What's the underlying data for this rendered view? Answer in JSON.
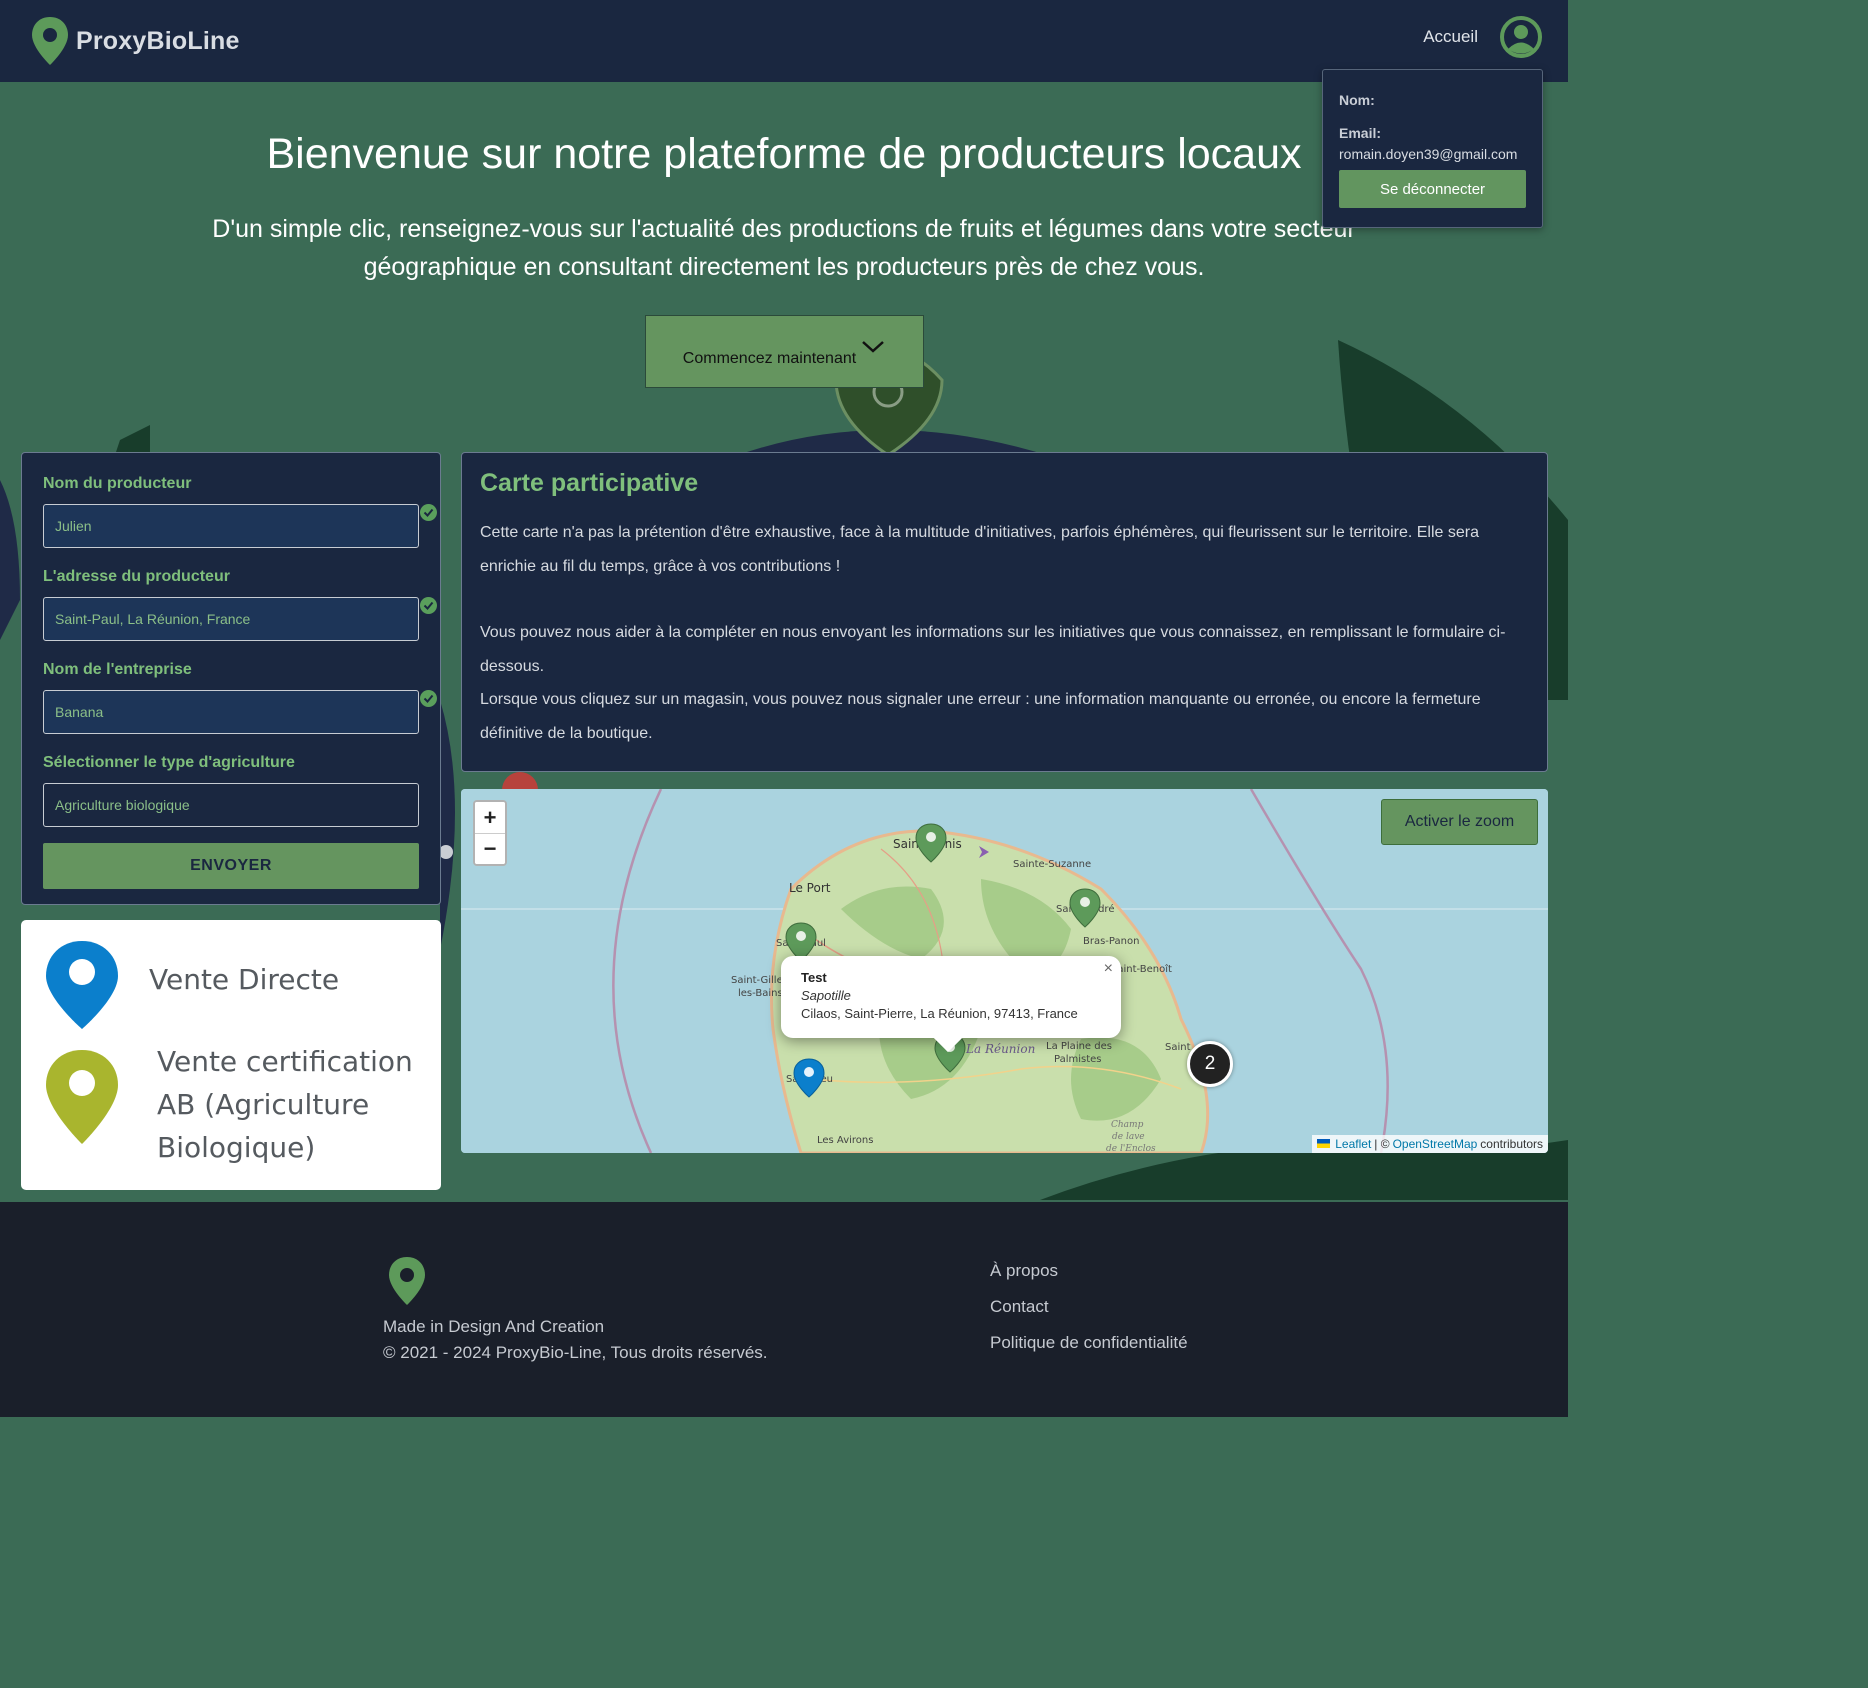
{
  "brand": {
    "name": "ProxyBioLine"
  },
  "nav": {
    "home": "Accueil"
  },
  "user_menu": {
    "name_label": "Nom:",
    "email_label": "Email:",
    "email": "romain.doyen39@gmail.com",
    "logout": "Se déconnecter"
  },
  "hero": {
    "title": "Bienvenue sur notre plateforme de producteurs locaux",
    "subtitle": "D'un simple clic, renseignez-vous sur l'actualité des productions de fruits et légumes dans votre secteur géographique en consultant directement les producteurs près de chez vous.",
    "cta": "Commencez maintenant"
  },
  "form": {
    "producer_label": "Nom du producteur",
    "producer_value": "Julien",
    "address_label": "L'adresse du producteur",
    "address_value": "Saint-Paul, La Réunion, France",
    "company_label": "Nom de l'entreprise",
    "company_value": "Banana",
    "type_label": "Sélectionner le type d'agriculture",
    "type_value": "Agriculture biologique",
    "submit": "ENVOYER"
  },
  "legend": {
    "direct": "Vente Directe",
    "certified_line1": "Vente certification",
    "certified_line2": "AB (Agriculture",
    "certified_line3": "Biologique)",
    "colors": {
      "direct": "#0b7fcc",
      "certified": "#a9b52e"
    }
  },
  "info": {
    "title": "Carte participative",
    "p1": "Cette carte n'a pas la prétention d'être exhaustive, face à la multitude d'initiatives, parfois éphémères, qui fleurissent sur le territoire. Elle sera enrichie au fil du temps, grâce à vos contributions !",
    "p2": "Vous pouvez nous aider à la compléter en nous envoyant les informations sur les initiatives que vous connaissez, en remplissant le formulaire ci-dessous.",
    "p3": "Lorsque vous cliquez sur un magasin, vous pouvez nous signaler une erreur : une information manquante ou erronée, ou encore la fermeture définitive de la boutique."
  },
  "map": {
    "zoom_in": "+",
    "zoom_out": "−",
    "activate_zoom": "Activer le zoom",
    "popup": {
      "name": "Test",
      "type": "Sapotille",
      "address": "Cilaos, Saint-Pierre, La Réunion, 97413, France",
      "close": "×"
    },
    "cluster_count": "2",
    "places": {
      "saint_denis": "Saint-Denis",
      "sainte_suzanne": "Sainte-Suzanne",
      "le_port": "Le Port",
      "saint_andre": "Saint-André",
      "bras_panon": "Bras-Panon",
      "saint_benoit": "Saint-Benoît",
      "saint_paul": "Saint-Paul",
      "saint_gilles": "Saint-Gilles-les-Bains",
      "la_reunion": "La Réunion",
      "plaine_palmistes": "La Plaine des Palmistes",
      "saint_leu": "Saint-Leu",
      "les_avirons": "Les Avirons",
      "champ_lave": "Champ de lave de l'Enclos",
      "saint_philippe": "Saint"
    },
    "attribution": {
      "leaflet": "Leaflet",
      "sep": "| ©",
      "osm": "OpenStreetMap",
      "contributors": "contributors"
    },
    "marker_colors": {
      "green": "#5d9a5a",
      "blue": "#0b7fcc"
    }
  },
  "footer": {
    "made": "Made in Design And Creation",
    "copyright": "© 2021 - 2024 ProxyBio-Line, Tous droits réservés.",
    "links": [
      "À propos",
      "Contact",
      "Politique de confidentialité"
    ]
  }
}
